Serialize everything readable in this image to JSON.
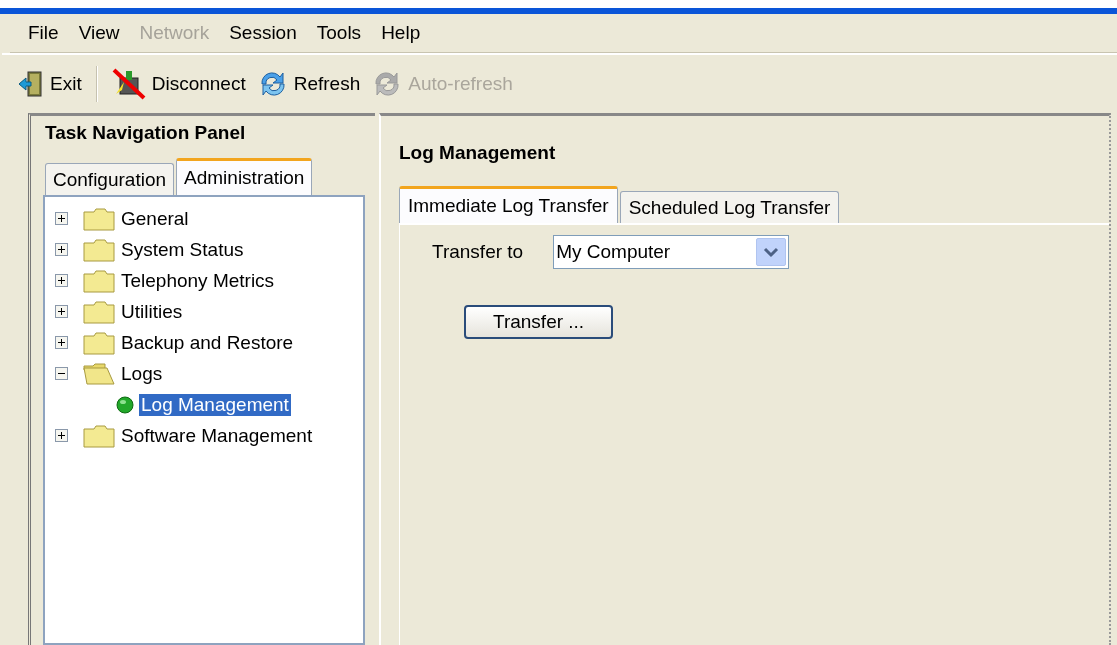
{
  "menu": [
    {
      "label": "File",
      "disabled": false
    },
    {
      "label": "View",
      "disabled": false
    },
    {
      "label": "Network",
      "disabled": true
    },
    {
      "label": "Session",
      "disabled": false
    },
    {
      "label": "Tools",
      "disabled": false
    },
    {
      "label": "Help",
      "disabled": false
    }
  ],
  "toolbar": [
    {
      "kind": "exit",
      "label": "Exit",
      "disabled": false
    },
    {
      "kind": "disconnect",
      "label": "Disconnect",
      "disabled": false
    },
    {
      "kind": "refresh",
      "label": "Refresh",
      "disabled": false
    },
    {
      "kind": "autorefresh",
      "label": "Auto-refresh",
      "disabled": true
    }
  ],
  "nav_panel": {
    "title": "Task Navigation Panel",
    "tabs": [
      {
        "label": "Configuration",
        "selected": false
      },
      {
        "label": "Administration",
        "selected": true
      }
    ],
    "tree": [
      {
        "kind": "folder",
        "label": "General",
        "expanded": false,
        "selected": false
      },
      {
        "kind": "folder",
        "label": "System Status",
        "expanded": false,
        "selected": false
      },
      {
        "kind": "folder",
        "label": "Telephony Metrics",
        "expanded": false,
        "selected": false
      },
      {
        "kind": "folder",
        "label": "Utilities",
        "expanded": false,
        "selected": false
      },
      {
        "kind": "folder",
        "label": "Backup and Restore",
        "expanded": false,
        "selected": false
      },
      {
        "kind": "folder",
        "label": "Logs",
        "expanded": true,
        "selected": false,
        "children": [
          {
            "kind": "leaf",
            "label": "Log Management",
            "selected": true
          }
        ]
      },
      {
        "kind": "folder",
        "label": "Software Management",
        "expanded": false,
        "selected": false
      }
    ]
  },
  "content": {
    "title": "Log Management",
    "tabs": [
      {
        "label": "Immediate Log Transfer",
        "selected": true
      },
      {
        "label": "Scheduled Log Transfer",
        "selected": false
      }
    ],
    "transfer_to": {
      "label": "Transfer to",
      "value": "My Computer"
    },
    "button": "Transfer ..."
  }
}
